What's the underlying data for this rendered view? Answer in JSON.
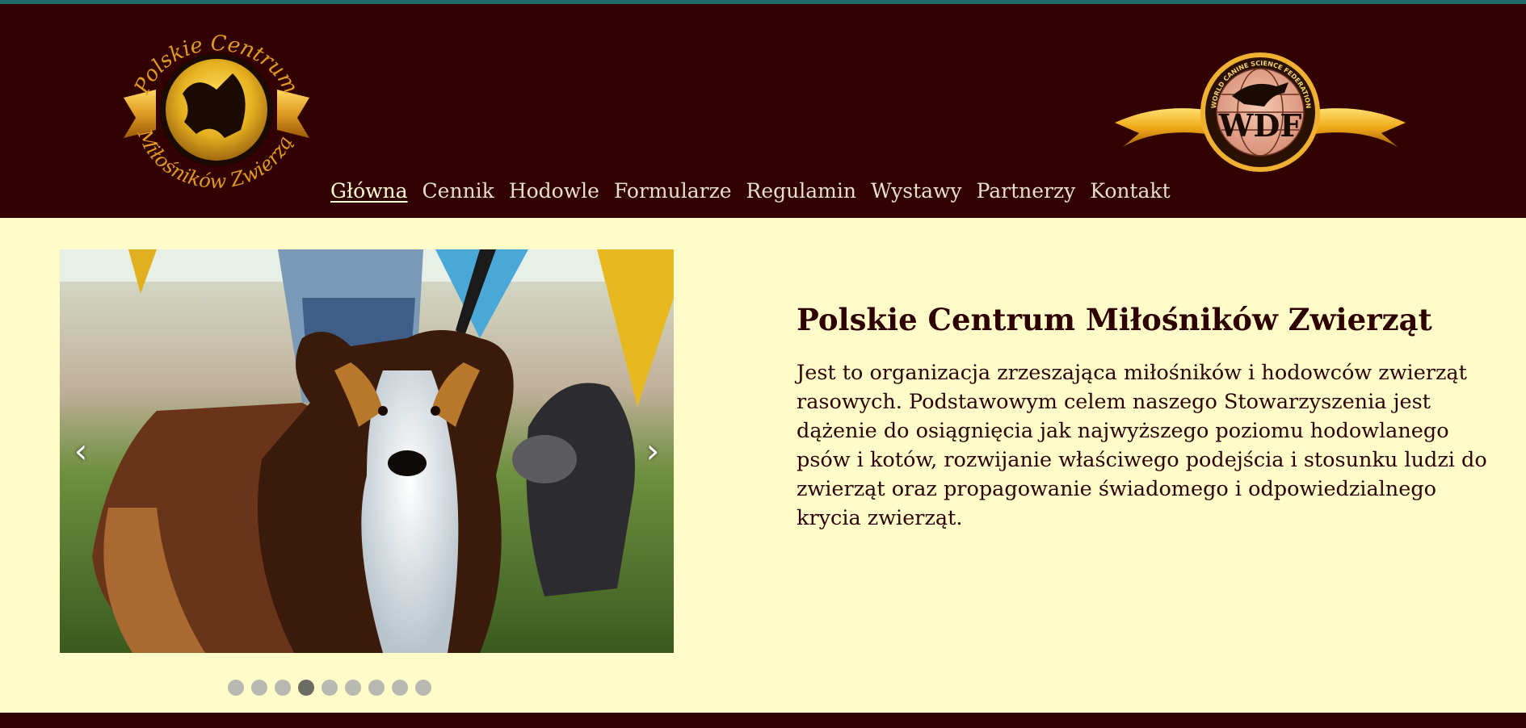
{
  "colors": {
    "header_bg": "#320000",
    "top_strip": "#1d6a6a",
    "page_bg": "#fefcc8",
    "text": "#2e0000",
    "nav_text": "#e6dfc9",
    "gold": "#e0a020"
  },
  "header": {
    "logo_left": {
      "icon": "pcmz-logo",
      "text_top": "Polskie Centrum",
      "text_bottom": "Miłośników Zwierząt"
    },
    "logo_right": {
      "icon": "wdf-logo",
      "badge_text": "WDF",
      "ring_text": "WORLD CANINE SCIENCE FEDERATION"
    }
  },
  "nav": {
    "items": [
      {
        "label": "Główna",
        "active": true
      },
      {
        "label": "Cennik"
      },
      {
        "label": "Hodowle"
      },
      {
        "label": "Formularze"
      },
      {
        "label": "Regulamin"
      },
      {
        "label": "Wystawy"
      },
      {
        "label": "Partnerzy"
      },
      {
        "label": "Kontakt"
      }
    ]
  },
  "carousel": {
    "prev_icon": "chevron-left-icon",
    "prev_symbol": "‹",
    "next_icon": "chevron-right-icon",
    "next_symbol": "›",
    "slide_count": 9,
    "active_slide": 4
  },
  "intro": {
    "title": "Polskie Centrum Miłośników Zwierząt",
    "body": "Jest to organizacja zrzeszająca miłośników i hodowców zwierząt rasowych. Podstawowym celem naszego Stowarzyszenia jest dążenie do osiągnięcia jak najwyższego poziomu hodowlanego psów i kotów, rozwijanie właściwego podejścia i stosunku ludzi do zwierząt oraz propagowanie świadomego i odpowiedzialnego krycia zwierząt."
  }
}
